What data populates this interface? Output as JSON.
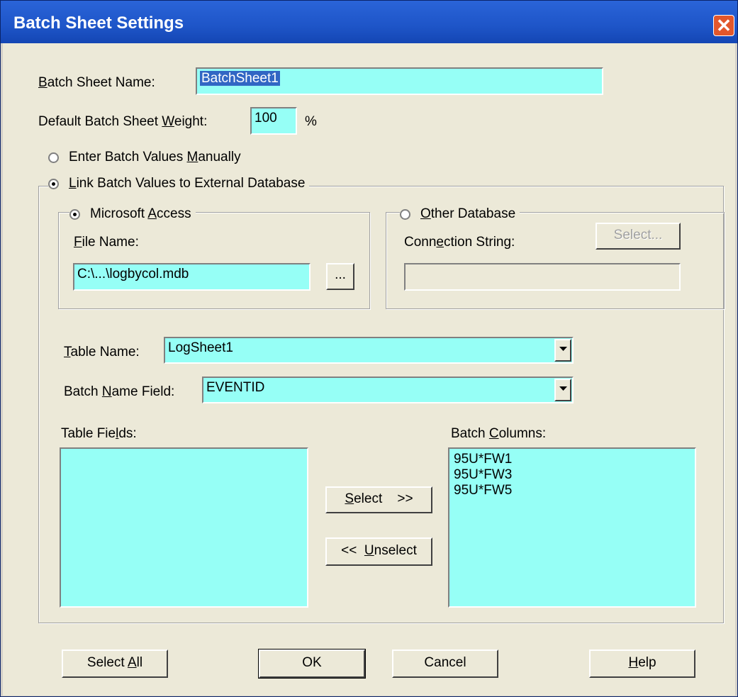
{
  "window": {
    "title": "Batch Sheet Settings",
    "close_glyph": "✕"
  },
  "batch_sheet_name": {
    "label_u": "B",
    "label_rest": "atch Sheet Name:",
    "value": "BatchSheet1"
  },
  "default_weight": {
    "label_a": "Default Batch Sheet ",
    "label_u": "W",
    "label_b": "eight:",
    "value": "100",
    "unit": "%"
  },
  "entry_mode": {
    "manual": {
      "label_a": "Enter Batch Values ",
      "label_u": "M",
      "label_b": "anually",
      "checked": false
    },
    "linked": {
      "label_u": "L",
      "label_rest": "ink Batch Values to External Database",
      "checked": true
    }
  },
  "access_group": {
    "radio_label_a": "Microsoft ",
    "radio_label_u": "A",
    "radio_label_b": "ccess",
    "checked": true,
    "file_label_u": "F",
    "file_label_rest": "ile Name:",
    "file_value": "C:\\...\\logbycol.mdb",
    "browse_label": "..."
  },
  "other_group": {
    "radio_label_u": "O",
    "radio_label_rest": "ther Database",
    "checked": false,
    "conn_label_a": "Conn",
    "conn_label_u": "e",
    "conn_label_b": "ction String:",
    "select_label": "Select...",
    "conn_value": ""
  },
  "table_name": {
    "label_u": "T",
    "label_rest": "able Name:",
    "value": "LogSheet1"
  },
  "batch_name_field": {
    "label_a": "Batch ",
    "label_u": "N",
    "label_b": "ame Field:",
    "value": "EVENTID"
  },
  "table_fields": {
    "label_a": "Table Fie",
    "label_u": "l",
    "label_b": "ds:",
    "items": []
  },
  "batch_columns": {
    "label_a": "Batch ",
    "label_u": "C",
    "label_b": "olumns:",
    "items": [
      "95U*FW1",
      "95U*FW3",
      "95U*FW5"
    ]
  },
  "move_buttons": {
    "select_u": "S",
    "select_rest": "elect",
    "select_arrows": ">>",
    "unselect_arrows": "<<",
    "unselect_u": "U",
    "unselect_rest": "nselect"
  },
  "footer": {
    "select_all_a": "Select ",
    "select_all_u": "A",
    "select_all_b": "ll",
    "ok": "OK",
    "cancel": "Cancel",
    "help_u": "H",
    "help_rest": "elp"
  },
  "colors": {
    "field_bg": "#96fff6",
    "dialog_bg": "#ece9d8",
    "title_blue": "#1e55c8",
    "close_red": "#e2572c"
  }
}
